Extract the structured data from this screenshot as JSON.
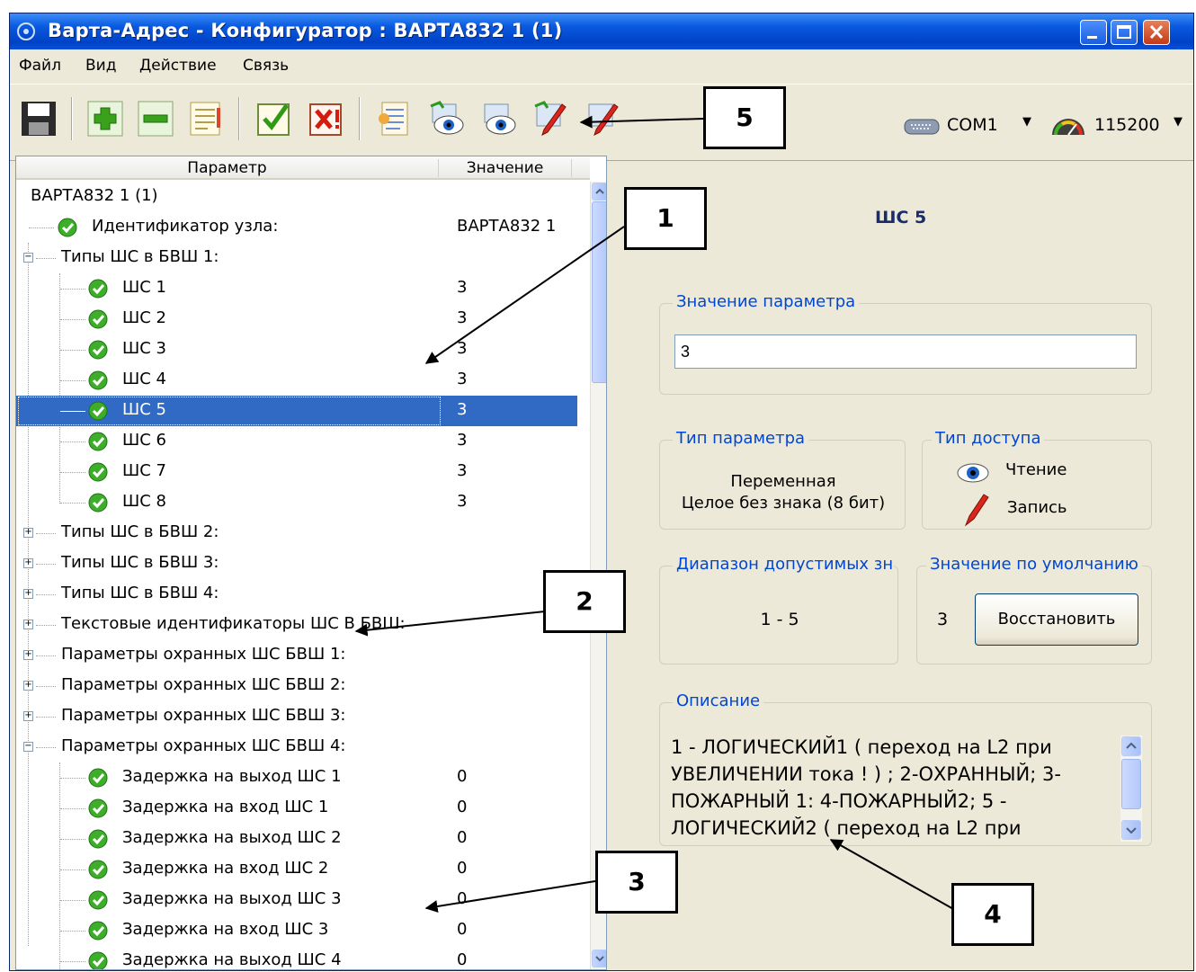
{
  "window": {
    "title": "Варта-Адрес - Конфигуратор : ВАРТА832 1 (1)"
  },
  "menu": [
    "Файл",
    "Вид",
    "Действие",
    "Связь"
  ],
  "toolbar": {
    "buttons": [
      "save-icon",
      "add-icon",
      "remove-icon",
      "list-icon",
      "check-icon",
      "delete-icon",
      "tree-config-icon",
      "read-eye-icon",
      "read-all-icon",
      "write-pen-icon",
      "write-all-icon"
    ],
    "port": "COM1",
    "baud": "115200"
  },
  "tree": {
    "header_param": "Параметр",
    "header_value": "Значение",
    "rows": [
      {
        "label": "ВАРТА832 1 (1)",
        "value": ""
      },
      {
        "label": "Идентификатор узла:",
        "value": "ВАРТА832 1"
      },
      {
        "label": "Типы ШС в БВШ 1:",
        "value": ""
      },
      {
        "label": "ШС 1",
        "value": "3"
      },
      {
        "label": "ШС 2",
        "value": "3"
      },
      {
        "label": "ШС 3",
        "value": "3"
      },
      {
        "label": "ШС 4",
        "value": "3"
      },
      {
        "label": "ШС 5",
        "value": "3"
      },
      {
        "label": "ШС 6",
        "value": "3"
      },
      {
        "label": "ШС 7",
        "value": "3"
      },
      {
        "label": "ШС 8",
        "value": "3"
      },
      {
        "label": "Типы ШС в БВШ 2:",
        "value": ""
      },
      {
        "label": "Типы ШС в БВШ 3:",
        "value": ""
      },
      {
        "label": "Типы ШС в БВШ 4:",
        "value": ""
      },
      {
        "label": "Текстовые идентификаторы ШС В БВШ:",
        "value": ""
      },
      {
        "label": "Параметры охранных ШС БВШ 1:",
        "value": ""
      },
      {
        "label": "Параметры охранных ШС БВШ 2:",
        "value": ""
      },
      {
        "label": "Параметры охранных ШС БВШ 3:",
        "value": ""
      },
      {
        "label": "Параметры охранных ШС БВШ 4:",
        "value": ""
      },
      {
        "label": "Задержка на выход ШС 1",
        "value": "0"
      },
      {
        "label": "Задержка на вход ШС 1",
        "value": "0"
      },
      {
        "label": "Задержка на выход ШС 2",
        "value": "0"
      },
      {
        "label": "Задержка на вход ШС 2",
        "value": "0"
      },
      {
        "label": "Задержка на выход ШС 3",
        "value": "0"
      },
      {
        "label": "Задержка на вход ШС 3",
        "value": "0"
      },
      {
        "label": "Задержка на выход ШС 4",
        "value": "0"
      }
    ]
  },
  "details": {
    "title": "ШС 5",
    "value_group": "Значение параметра",
    "value": "3",
    "type_group": "Тип параметра",
    "type_line1": "Переменная",
    "type_line2": "Целое без знака (8 бит)",
    "access_group": "Тип доступа",
    "access_read": "Чтение",
    "access_write": "Запись",
    "range_group": "Диапазон допустимых зн",
    "range": "1 - 5",
    "default_group": "Значение по умолчанию",
    "default_value": "3",
    "restore_button": "Восстановить",
    "desc_group": "Описание",
    "description": "1 - ЛОГИЧЕСКИЙ1 ( переход на L2 при УВЕЛИЧЕНИИ тока ! ) ; 2-ОХРАННЫЙ; 3-ПОЖАРНЫЙ 1: 4-ПОЖАРНЫЙ2; 5 - ЛОГИЧЕСКИЙ2 ( переход на L2 при"
  },
  "callouts": [
    "1",
    "2",
    "3",
    "4",
    "5"
  ]
}
